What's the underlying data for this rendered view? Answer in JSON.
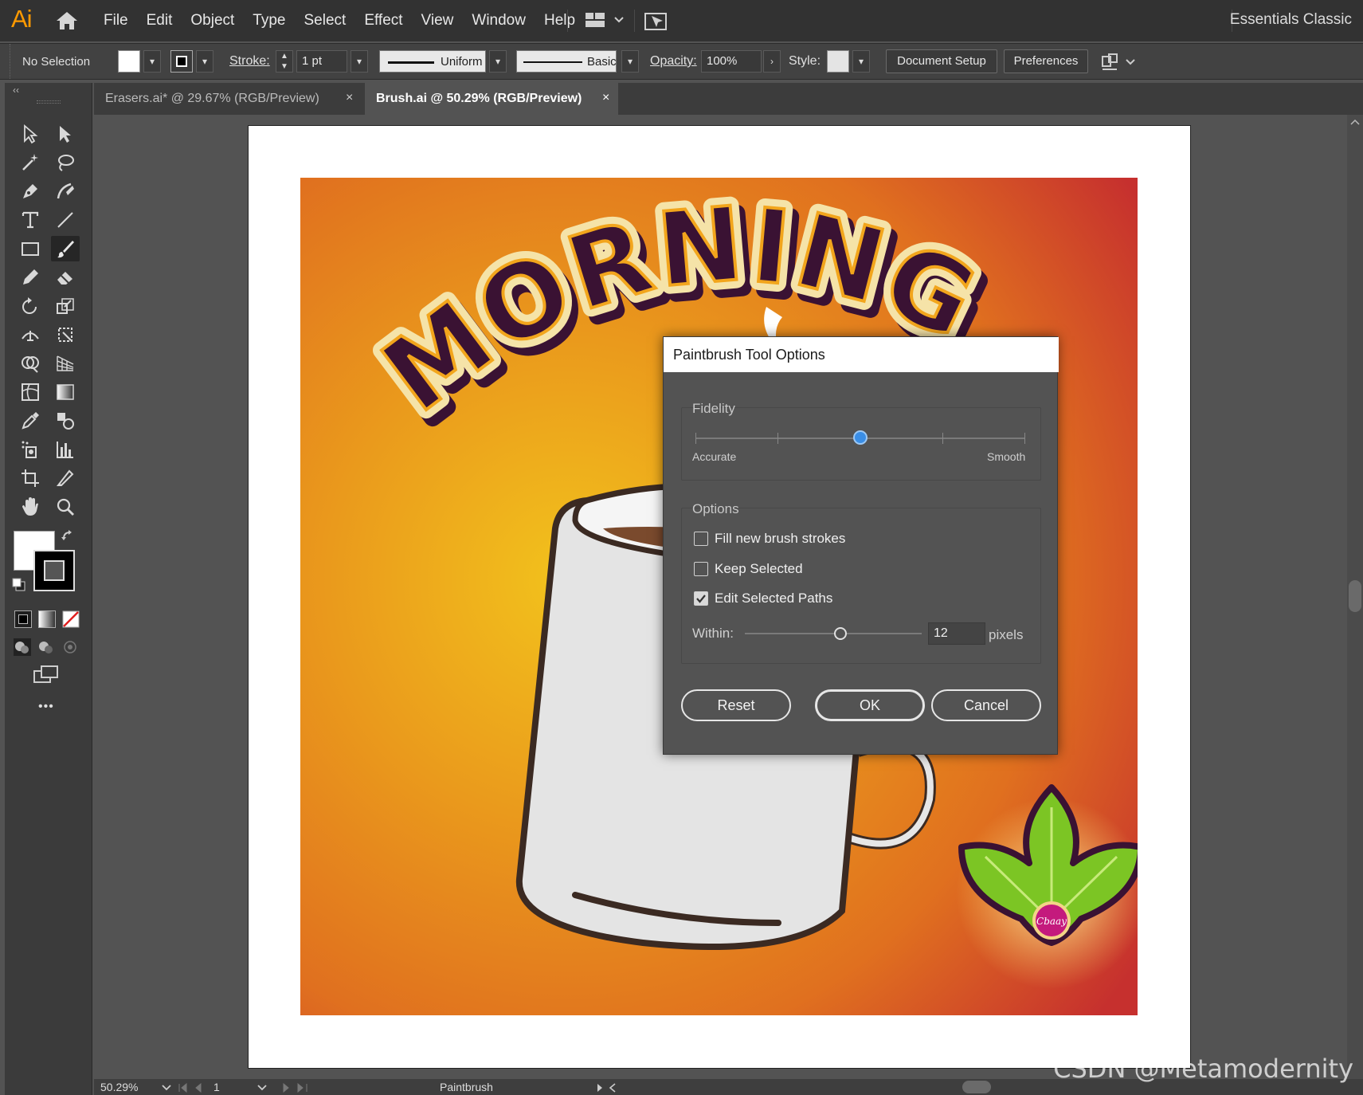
{
  "app": {
    "logo": "Ai",
    "workspace": "Essentials Classic"
  },
  "menu": [
    "File",
    "Edit",
    "Object",
    "Type",
    "Select",
    "Effect",
    "View",
    "Window",
    "Help"
  ],
  "control": {
    "selection": "No Selection",
    "stroke_label": "Stroke:",
    "stroke_value": "1 pt",
    "profile": "Uniform",
    "brush": "Basic",
    "opacity_label": "Opacity:",
    "opacity_value": "100%",
    "style_label": "Style:",
    "document_setup": "Document Setup",
    "preferences": "Preferences"
  },
  "tabs": [
    {
      "label": "Erasers.ai* @ 29.67% (RGB/Preview)",
      "active": false
    },
    {
      "label": "Brush.ai @ 50.29% (RGB/Preview)",
      "active": true
    }
  ],
  "tab_close": "×",
  "toolbar_collapse": "‹‹",
  "more_tools": "•••",
  "artwork": {
    "headline": "MORNING BREW",
    "badge": "Cbaay"
  },
  "status": {
    "zoom": "50.29%",
    "page": "1",
    "tool": "Paintbrush"
  },
  "dialog": {
    "title": "Paintbrush Tool Options",
    "fidelity": {
      "label": "Fidelity",
      "left": "Accurate",
      "right": "Smooth",
      "level": 0.5
    },
    "options": {
      "label": "Options",
      "fill_new": {
        "label": "Fill new brush strokes",
        "checked": false
      },
      "keep_selected": {
        "label": "Keep Selected",
        "checked": false
      },
      "edit_selected": {
        "label": "Edit Selected Paths",
        "checked": true
      },
      "within_label": "Within:",
      "within_value": "12",
      "within_unit": "pixels",
      "within_level": 0.55
    },
    "reset": "Reset",
    "ok": "OK",
    "cancel": "Cancel"
  },
  "watermark": "CSDN @Metamodernity",
  "colors": {
    "accent": "#ff9a00",
    "slider_thumb": "#3a8ee6",
    "bg_orange": "#e8751f",
    "bg_red": "#c6302e",
    "bg_yellow": "#f2c21c"
  }
}
